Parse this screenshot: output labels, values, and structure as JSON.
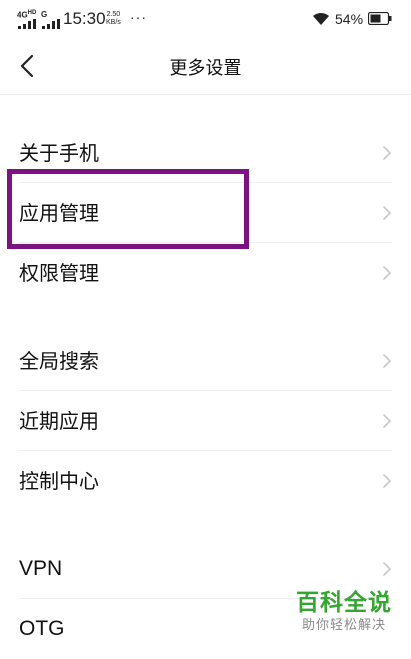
{
  "status_bar": {
    "network1": "4G",
    "network1_suffix": "HD",
    "network2": "G",
    "time": "15:30",
    "speed_value": "2.50",
    "speed_unit": "KB/s",
    "overflow": "···",
    "battery": "54%"
  },
  "header": {
    "title": "更多设置",
    "back_icon": "chevron-left-icon"
  },
  "groups": [
    {
      "items": [
        {
          "label": "关于手机"
        },
        {
          "label": "应用管理"
        },
        {
          "label": "权限管理"
        }
      ]
    },
    {
      "items": [
        {
          "label": "全局搜索"
        },
        {
          "label": "近期应用"
        },
        {
          "label": "控制中心"
        }
      ]
    },
    {
      "items": [
        {
          "label": "VPN"
        },
        {
          "label": "OTG"
        }
      ]
    }
  ],
  "highlight": {
    "target": "应用管理",
    "color": "#7b1380"
  },
  "watermark": {
    "title": "百科全说",
    "subtitle": "助你轻松解决",
    "color": "#35a532"
  }
}
